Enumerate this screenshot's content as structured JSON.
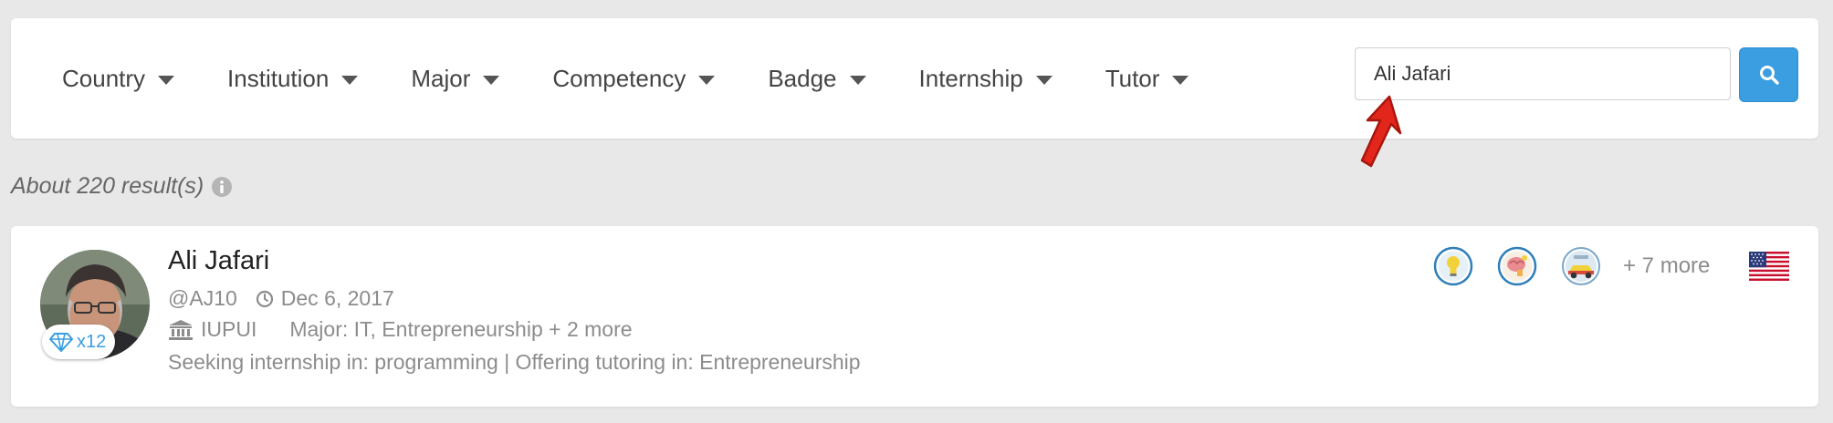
{
  "filters": [
    {
      "label": "Country"
    },
    {
      "label": "Institution"
    },
    {
      "label": "Major"
    },
    {
      "label": "Competency"
    },
    {
      "label": "Badge"
    },
    {
      "label": "Internship"
    },
    {
      "label": "Tutor"
    }
  ],
  "search": {
    "value": "Ali Jafari",
    "placeholder": ""
  },
  "results": {
    "count_text": "About 220 result(s)"
  },
  "result": {
    "name": "Ali Jafari",
    "handle": "@AJ10",
    "date": "Dec 6, 2017",
    "institution": "IUPUI",
    "major": "Major: IT, Entrepreneurship + 2 more",
    "seeking": "Seeking internship in: programming | Offering tutoring in: Entrepreneurship",
    "diamond_count": "x12",
    "more_badges": "+ 7 more",
    "badges": [
      "lightbulb-badge-icon",
      "brain-badge-icon",
      "race-car-badge-icon"
    ],
    "flag": "us-flag-icon"
  },
  "colors": {
    "accent": "#3a9ee0",
    "background": "#e8e8e8",
    "annotation": "#e3261b"
  }
}
